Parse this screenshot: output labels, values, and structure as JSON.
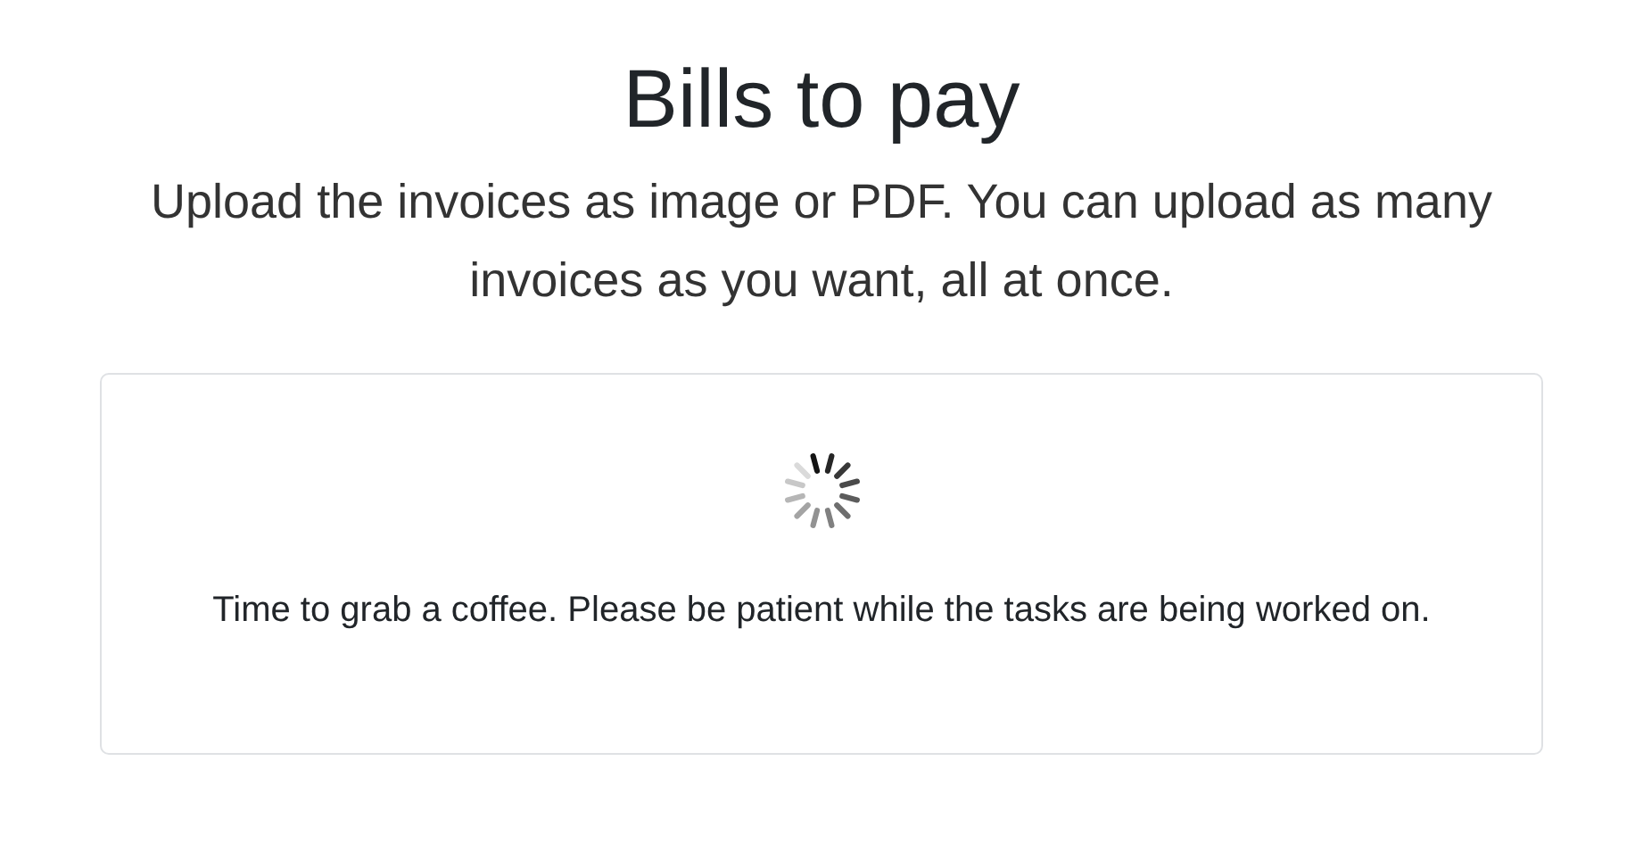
{
  "title": "Bills to pay",
  "subtitle": "Upload the invoices as image or PDF. You can upload as many invoices as you want, all at once.",
  "status_card": {
    "loading": true,
    "message": "Time to grab a coffee. Please be patient while the tasks are being worked on."
  }
}
